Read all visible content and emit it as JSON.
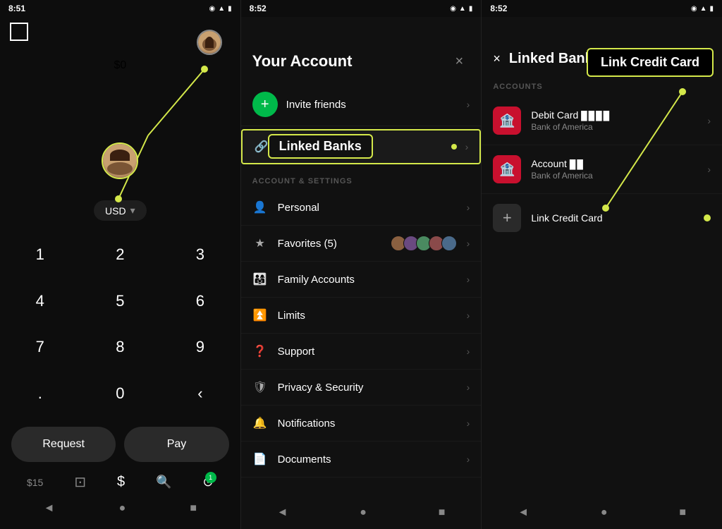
{
  "panel1": {
    "status_time": "8:51",
    "balance": "$0",
    "usd_label": "USD",
    "numpad": [
      "1",
      "2",
      "3",
      "4",
      "5",
      "6",
      "7",
      "8",
      "9",
      ".",
      "0",
      "‹"
    ],
    "request_label": "Request",
    "pay_label": "Pay",
    "amount_hint": "$15",
    "nav_items": [
      "◄",
      "●",
      "■",
      "$",
      "☁",
      "1"
    ]
  },
  "panel2": {
    "status_time": "8:52",
    "title": "Your Account",
    "close_label": "×",
    "invite_label": "Invite friends",
    "linked_banks_label": "Linked Banks",
    "linked_banks_callout": "Linked Banks",
    "section_label": "ACCOUNT & SETTINGS",
    "menu_items": [
      {
        "icon": "👤",
        "label": "Personal",
        "extra": ""
      },
      {
        "icon": "★",
        "label": "Favorites (5)",
        "extra": "avatars"
      },
      {
        "icon": "🔗",
        "label": "Linked Banks",
        "extra": "dot"
      },
      {
        "icon": "👨‍👩‍👧",
        "label": "Family Accounts",
        "extra": ""
      },
      {
        "icon": "⏫",
        "label": "Limits",
        "extra": ""
      },
      {
        "icon": "❓",
        "label": "Support",
        "extra": ""
      },
      {
        "icon": "🛡",
        "label": "Privacy & Security",
        "extra": ""
      },
      {
        "icon": "🔔",
        "label": "Notifications",
        "extra": ""
      },
      {
        "icon": "📄",
        "label": "Documents",
        "extra": ""
      }
    ]
  },
  "panel3": {
    "status_time": "8:52",
    "title": "Linked Banks",
    "back_label": "×",
    "section_label": "ACCOUNTS",
    "link_credit_card_callout": "Link Credit Card",
    "accounts": [
      {
        "type": "Debit Card",
        "masked": "████",
        "bank": "Bank of America"
      },
      {
        "type": "Account",
        "masked": "██",
        "bank": "Bank of America"
      }
    ],
    "link_cc_label": "Link Credit Card"
  }
}
